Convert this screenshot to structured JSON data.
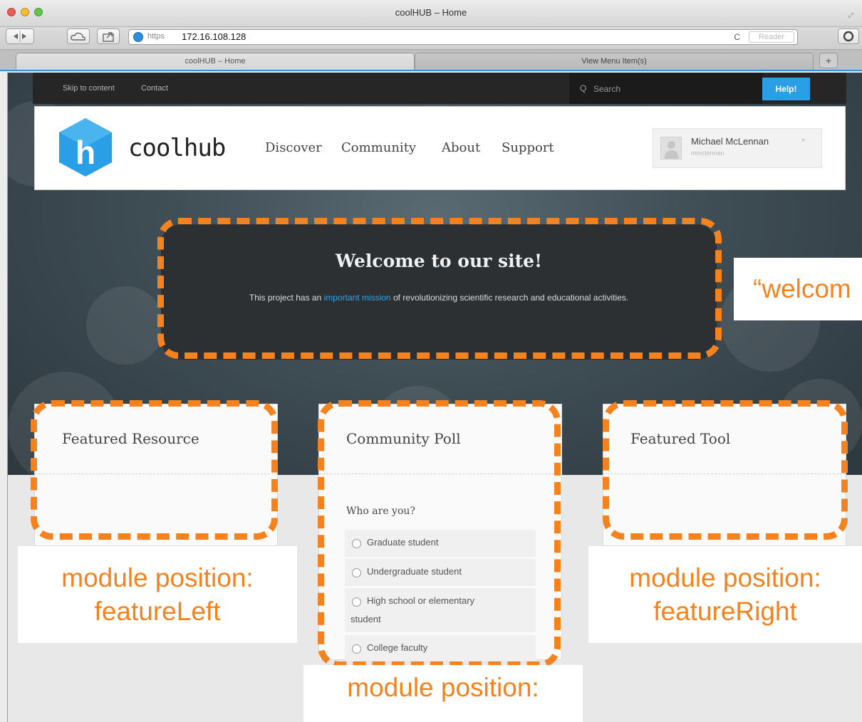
{
  "browser": {
    "window_title": "coolHUB – Home",
    "corner_glyph": "⤢",
    "url_scheme": "https",
    "url_host": "172.16.108.128",
    "reload_glyph": "C",
    "reader_label": "Reader",
    "tabs": [
      {
        "label": "coolHUB – Home",
        "active": true
      },
      {
        "label": "View Menu Item(s)",
        "active": false
      }
    ],
    "new_tab": "+"
  },
  "utility": {
    "links": [
      "Skip to content",
      "Contact"
    ],
    "search_placeholder": "Search",
    "help_label": "Help!"
  },
  "header": {
    "logo_letter": "h",
    "logo_text": "coolhub",
    "nav": [
      "Discover",
      "Community",
      "About",
      "Support"
    ],
    "user_name": "Michael McLennan",
    "user_login": "mmclennan"
  },
  "welcome": {
    "title": "Welcome to our site!",
    "text_before": "This project has an ",
    "text_link": "important mission",
    "text_after": " of revolutionizing scientific research and educational activities."
  },
  "cards": {
    "left_title": "Featured Resource",
    "mid_title": "Community Poll",
    "right_title": "Featured Tool",
    "poll_question": "Who are you?",
    "poll_options": [
      {
        "line1": "Graduate student",
        "line2": ""
      },
      {
        "line1": "Undergraduate student",
        "line2": ""
      },
      {
        "line1": "High school or elementary",
        "line2": "student"
      },
      {
        "line1": "College faculty",
        "line2": ""
      }
    ]
  },
  "annotations": {
    "accent_color": "#f4831f",
    "welcome_label": "“welcom",
    "left_line1": "module position:",
    "left_line2": "featureLeft",
    "right_line1": "module position:",
    "right_line2": "featureRight",
    "mid_line1": "module position:"
  },
  "colors": {
    "help_button": "#2a9fe6",
    "logo_blue": "#2a9fe6",
    "link_blue": "#30a5e8"
  }
}
